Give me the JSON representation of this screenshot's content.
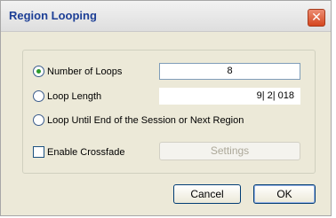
{
  "dialog": {
    "title": "Region Looping",
    "close_glyph": "✕"
  },
  "options": {
    "number_of_loops": {
      "label": "Number of Loops",
      "selected": true,
      "value": "8"
    },
    "loop_length": {
      "label": "Loop Length",
      "selected": false,
      "value": "9| 2| 018"
    },
    "loop_until_end": {
      "label": "Loop Until End of the Session or Next Region",
      "selected": false
    }
  },
  "crossfade": {
    "label": "Enable Crossfade",
    "checked": false,
    "settings_label": "Settings"
  },
  "buttons": {
    "cancel": "Cancel",
    "ok": "OK"
  },
  "colors": {
    "title_text": "#1d3f96",
    "close_button": "#d5461f",
    "dialog_background": "#ece9d8"
  }
}
